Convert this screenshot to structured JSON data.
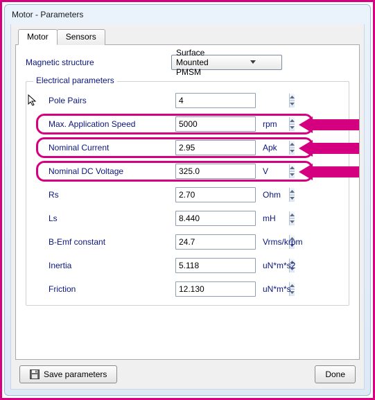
{
  "window": {
    "title": "Motor - Parameters"
  },
  "tabs": {
    "motor": "Motor",
    "sensors": "Sensors"
  },
  "magnetic": {
    "label": "Magnetic structure",
    "selected": "Surface Mounted PMSM"
  },
  "group": {
    "legend": "Electrical parameters"
  },
  "params": {
    "pole_pairs": {
      "label": "Pole Pairs",
      "value": "4",
      "unit": ""
    },
    "max_speed": {
      "label": "Max. Application Speed",
      "value": "5000",
      "unit": "rpm"
    },
    "nominal_i": {
      "label": "Nominal Current",
      "value": "2.95",
      "unit": "Apk"
    },
    "nominal_vdc": {
      "label": "Nominal DC Voltage",
      "value": "325.0",
      "unit": "V"
    },
    "rs": {
      "label": "Rs",
      "value": "2.70",
      "unit": "Ohm"
    },
    "ls": {
      "label": "Ls",
      "value": "8.440",
      "unit": "mH"
    },
    "bemf": {
      "label": "B-Emf constant",
      "value": "24.7",
      "unit": "Vrms/krpm"
    },
    "inertia": {
      "label": "Inertia",
      "value": "5.118",
      "unit": "uN*m*s2"
    },
    "friction": {
      "label": "Friction",
      "value": "12.130",
      "unit": "uN*m*s"
    }
  },
  "buttons": {
    "save": "Save parameters",
    "done": "Done"
  }
}
